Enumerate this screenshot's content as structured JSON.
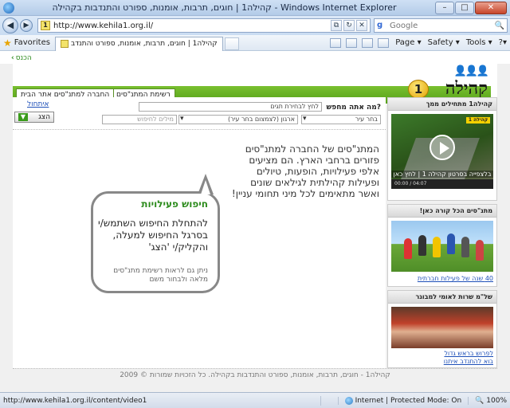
{
  "browser": {
    "title": "קהילה1 | חוגים, תרבות, אומנות, ספורט והתנדבות בקהילה - Windows Internet Explorer",
    "url": "http://www.kehila1.org.il/",
    "search_placeholder": "Google",
    "favorites_label": "Favorites",
    "tab_title": "קהילה1 | חוגים, תרבות, אומנות, ספורט והתנדב",
    "tools": {
      "page": "Page ▾",
      "safety": "Safety ▾",
      "tools": "Tools ▾",
      "help": "?▾"
    }
  },
  "site": {
    "enter_link": "הכנס",
    "logo_people": "👤👤👤",
    "logo_word": "קהילה",
    "logo_number": "1",
    "nav": {
      "list_button": "רשימת המתנ\"סים",
      "company_button": "החברה למתנ\"סים אתר הבית"
    }
  },
  "search": {
    "label": "מה אתה מחפש?",
    "category_placeholder": "לחץ לבחירת תגים",
    "city_select": "בחר עיר",
    "org_select": "ארגון (לצמצום בחר עיר)",
    "keywords_placeholder": "מילים לחיפוש",
    "reset_link": "איתחול",
    "show_button": "הצג"
  },
  "intro": {
    "text": "המתנ\"סים של החברה למתנ\"סים פזורים ברחבי הארץ. הם מציעים אלפי פעילויות, הופעות, טיולים ופעילות קהילתית לגילאים שונים ואשר מתאימים לכל מיני תחומי עניין!"
  },
  "bubble": {
    "title": "חיפוש פעילויות",
    "main": "להתחלת החיפוש השתמש/י בסרגל החיפוש למעלה, והקליק/י 'הצג'",
    "sub": "ניתן גם לראות רשימת מתנ\"סים מלאה ולבחור משם"
  },
  "sidebar": {
    "box1": {
      "title": "קהילה1 מתחילים ממך",
      "video_badge": "קהילה 1",
      "video_caption": "בלצפייה בסרטון קהילה 1 | לחץ כאן",
      "video_time": "00:00 / 04:07"
    },
    "box2": {
      "title": "מתנ\"סים הכל קורה כאן!",
      "link": "40 שנה של פעילות חברתית"
    },
    "box3": {
      "title": "של\"מ שרות לאומי למבוגר",
      "link_line1": "לפרוש בראש גדול",
      "link_line2": "בוא להתנדב איתנו"
    }
  },
  "footer": {
    "text": "קהילה1 - חוגים, תרבות, אומנות, ספורט והתנדבות בקהילה. כל הזכויות שמורות © 2009"
  },
  "status": {
    "url": "http://www.kehila1.org.il/content/video1",
    "zone": "Internet | Protected Mode: On",
    "zoom": "100%"
  }
}
